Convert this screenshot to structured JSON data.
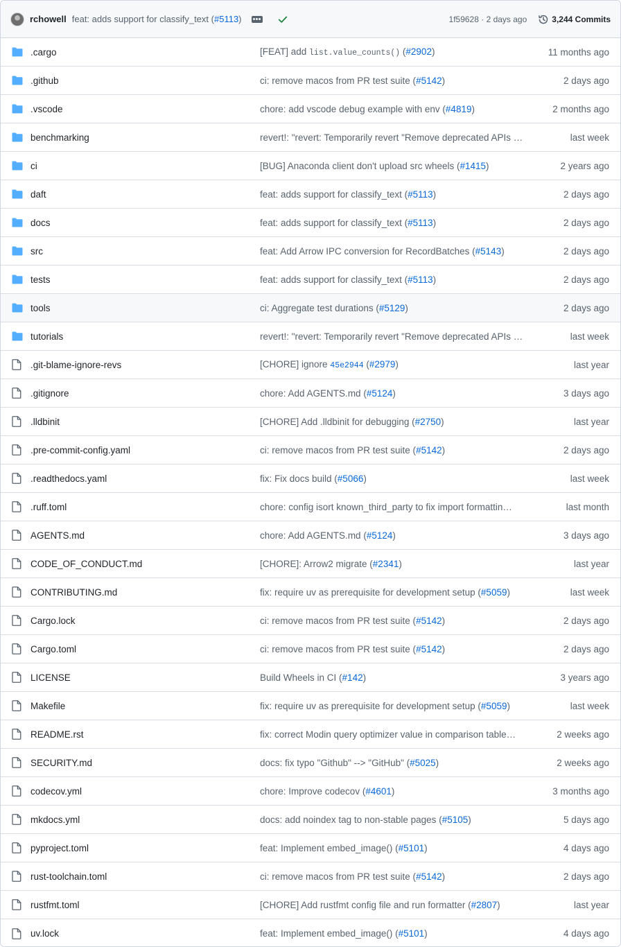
{
  "commit": {
    "author": "rchowell",
    "message": "feat: adds support for classify_text",
    "pr": "#5113",
    "sha_time": "1f59628 · 2 days ago",
    "commits_count": "3,244 Commits"
  },
  "colors": {
    "accent": "#0969da",
    "folder": "#54aeff",
    "success": "#1a7f37"
  },
  "files": [
    {
      "name": ".cargo",
      "type": "folder",
      "msg": "[FEAT] add ",
      "code": "list.value_counts()",
      "msg2": " (",
      "pr": "#2902",
      "age": "11 months ago"
    },
    {
      "name": ".github",
      "type": "folder",
      "msg": "ci: remove macos from PR test suite (",
      "pr": "#5142",
      "age": "2 days ago"
    },
    {
      "name": ".vscode",
      "type": "folder",
      "msg": "chore: add vscode debug example with env (",
      "pr": "#4819",
      "age": "2 months ago"
    },
    {
      "name": "benchmarking",
      "type": "folder",
      "msg": "revert!: \"revert: Temporarily revert \"Remove deprecated APIs …",
      "age": "last week"
    },
    {
      "name": "ci",
      "type": "folder",
      "msg": "[BUG] Anaconda client don't upload src wheels (",
      "pr": "#1415",
      "age": "2 years ago"
    },
    {
      "name": "daft",
      "type": "folder",
      "msg": "feat: adds support for classify_text (",
      "pr": "#5113",
      "age": "2 days ago"
    },
    {
      "name": "docs",
      "type": "folder",
      "msg": "feat: adds support for classify_text (",
      "pr": "#5113",
      "age": "2 days ago"
    },
    {
      "name": "src",
      "type": "folder",
      "msg": "feat: Add Arrow IPC conversion for RecordBatches (",
      "pr": "#5143",
      "age": "2 days ago"
    },
    {
      "name": "tests",
      "type": "folder",
      "msg": "feat: adds support for classify_text (",
      "pr": "#5113",
      "age": "2 days ago"
    },
    {
      "name": "tools",
      "type": "folder",
      "msg": "ci: Aggregate test durations (",
      "pr": "#5129",
      "age": "2 days ago"
    },
    {
      "name": "tutorials",
      "type": "folder",
      "msg": "revert!: \"revert: Temporarily revert \"Remove deprecated APIs …",
      "age": "last week"
    },
    {
      "name": ".git-blame-ignore-revs",
      "type": "file",
      "msg": "[CHORE] ignore ",
      "sha": "45e2944",
      "msg2": " (",
      "pr": "#2979",
      "age": "last year"
    },
    {
      "name": ".gitignore",
      "type": "file",
      "msg": "chore: Add AGENTS.md (",
      "pr": "#5124",
      "age": "3 days ago"
    },
    {
      "name": ".lldbinit",
      "type": "file",
      "msg": "[CHORE] Add .lldbinit for debugging (",
      "pr": "#2750",
      "age": "last year"
    },
    {
      "name": ".pre-commit-config.yaml",
      "type": "file",
      "msg": "ci: remove macos from PR test suite (",
      "pr": "#5142",
      "age": "2 days ago"
    },
    {
      "name": ".readthedocs.yaml",
      "type": "file",
      "msg": "fix: Fix docs build (",
      "pr": "#5066",
      "age": "last week"
    },
    {
      "name": ".ruff.toml",
      "type": "file",
      "msg": "chore: config isort known_third_party to fix import formattin…",
      "age": "last month"
    },
    {
      "name": "AGENTS.md",
      "type": "file",
      "msg": "chore: Add AGENTS.md (",
      "pr": "#5124",
      "age": "3 days ago"
    },
    {
      "name": "CODE_OF_CONDUCT.md",
      "type": "file",
      "msg": "[CHORE]: Arrow2 migrate (",
      "pr": "#2341",
      "age": "last year"
    },
    {
      "name": "CONTRIBUTING.md",
      "type": "file",
      "msg": "fix: require uv as prerequisite for development setup (",
      "pr": "#5059",
      "age": "last week"
    },
    {
      "name": "Cargo.lock",
      "type": "file",
      "msg": "ci: remove macos from PR test suite (",
      "pr": "#5142",
      "age": "2 days ago"
    },
    {
      "name": "Cargo.toml",
      "type": "file",
      "msg": "ci: remove macos from PR test suite (",
      "pr": "#5142",
      "age": "2 days ago"
    },
    {
      "name": "LICENSE",
      "type": "file",
      "msg": "Build Wheels in CI (",
      "pr": "#142",
      "age": "3 years ago"
    },
    {
      "name": "Makefile",
      "type": "file",
      "msg": "fix: require uv as prerequisite for development setup (",
      "pr": "#5059",
      "age": "last week"
    },
    {
      "name": "README.rst",
      "type": "file",
      "msg": "fix: correct Modin query optimizer value in comparison table…",
      "age": "2 weeks ago"
    },
    {
      "name": "SECURITY.md",
      "type": "file",
      "msg": "docs: fix typo \"Github\" --> \"GitHub\" (",
      "pr": "#5025",
      "age": "2 weeks ago"
    },
    {
      "name": "codecov.yml",
      "type": "file",
      "msg": "chore: Improve codecov (",
      "pr": "#4601",
      "age": "3 months ago"
    },
    {
      "name": "mkdocs.yml",
      "type": "file",
      "msg": "docs: add noindex tag to non-stable pages (",
      "pr": "#5105",
      "age": "5 days ago"
    },
    {
      "name": "pyproject.toml",
      "type": "file",
      "msg": "feat: Implement embed_image() (",
      "pr": "#5101",
      "age": "4 days ago"
    },
    {
      "name": "rust-toolchain.toml",
      "type": "file",
      "msg": "ci: remove macos from PR test suite (",
      "pr": "#5142",
      "age": "2 days ago"
    },
    {
      "name": "rustfmt.toml",
      "type": "file",
      "msg": "[CHORE] Add rustfmt config file and run formatter (",
      "pr": "#2807",
      "age": "last year"
    },
    {
      "name": "uv.lock",
      "type": "file",
      "msg": "feat: Implement embed_image() (",
      "pr": "#5101",
      "age": "4 days ago"
    }
  ]
}
